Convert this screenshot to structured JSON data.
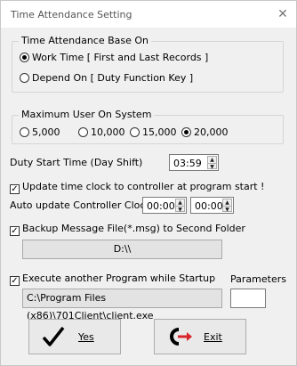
{
  "window": {
    "title": "Time Attendance Setting",
    "close_glyph": "✕"
  },
  "base_group": {
    "label": "Time Attendance Base On",
    "options": [
      {
        "label": "Work Time [ First and Last Records ]",
        "selected": true
      },
      {
        "label": "Depend On [ Duty Function Key ]",
        "selected": false
      }
    ]
  },
  "max_user_group": {
    "label": "Maximum User On System",
    "options": [
      {
        "label": "5,000",
        "selected": false
      },
      {
        "label": "10,000",
        "selected": false
      },
      {
        "label": "15,000",
        "selected": false
      },
      {
        "label": "20,000",
        "selected": true
      }
    ]
  },
  "duty_start": {
    "label": "Duty Start Time (Day Shift)",
    "value": "03:59"
  },
  "update_clock": {
    "label": "Update time clock to controller at program start !",
    "checked": true
  },
  "auto_update": {
    "label": "Auto update Controller Clock",
    "time1": "00:00",
    "time2": "00:00"
  },
  "backup": {
    "label": "Backup Message File(*.msg) to Second Folder",
    "checked": true,
    "folder": "D:\\\\"
  },
  "execute": {
    "label": "Execute another Program while Startup",
    "checked": true,
    "parameters_label": "Parameters",
    "path": "C:\\Program Files (x86)\\701Client\\client.exe",
    "parameters_value": ""
  },
  "buttons": {
    "yes": "Yes",
    "exit": "Exit"
  },
  "colors": {
    "accent_red": "#d8242a",
    "dialog_bg": "#f0f0f0"
  }
}
